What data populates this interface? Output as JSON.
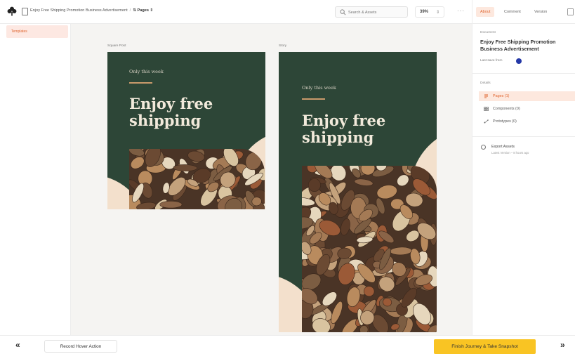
{
  "colors": {
    "accent": "#e0652f",
    "accent_bg": "#fde8de",
    "artwork_green": "#2d4637",
    "artwork_cream": "#f3e0cc",
    "cta_yellow": "#f9c423"
  },
  "topbar": {
    "logo_icon": "brand-flower-icon",
    "doc_icon": "file-icon",
    "doc_title": "Enjoy Free Shipping Promotion Business Advertisement",
    "separator": "/",
    "pages_label": "Pages",
    "pages_caret": "⇕",
    "search_placeholder": "Search & Assets",
    "zoom": "39%",
    "zoom_caret": "⇕",
    "more": "···",
    "tabs": {
      "about": "About",
      "comment": "Comment",
      "version": "Version"
    }
  },
  "left_panel": {
    "selected_page": "Templates"
  },
  "canvas": {
    "frames": [
      {
        "label": "Square Post",
        "subtitle": "Only this week",
        "headline": "Enjoy free\nshipping"
      },
      {
        "label": "Story",
        "subtitle": "Only this week",
        "headline": "Enjoy free\nshipping"
      }
    ]
  },
  "right_panel": {
    "document_label": "Document",
    "document_title": "Enjoy Free Shipping Promotion Business Advertisement",
    "last_save": "Last save from",
    "details_label": "Details",
    "items": [
      {
        "label": "Pages (1)",
        "icon": "pages-icon",
        "active": true
      },
      {
        "label": "Components (0)",
        "icon": "components-grid-icon",
        "active": false
      },
      {
        "label": "Prototypes (0)",
        "icon": "prototype-link-icon",
        "active": false
      }
    ],
    "export_title": "Export Assets",
    "export_sub": "Latest Version – 8 hours ago"
  },
  "bottom_bar": {
    "prev": "«",
    "next": "»",
    "record_label": "Record Hover Action",
    "finish_label": "Finish Journey & Take Snapshot"
  }
}
